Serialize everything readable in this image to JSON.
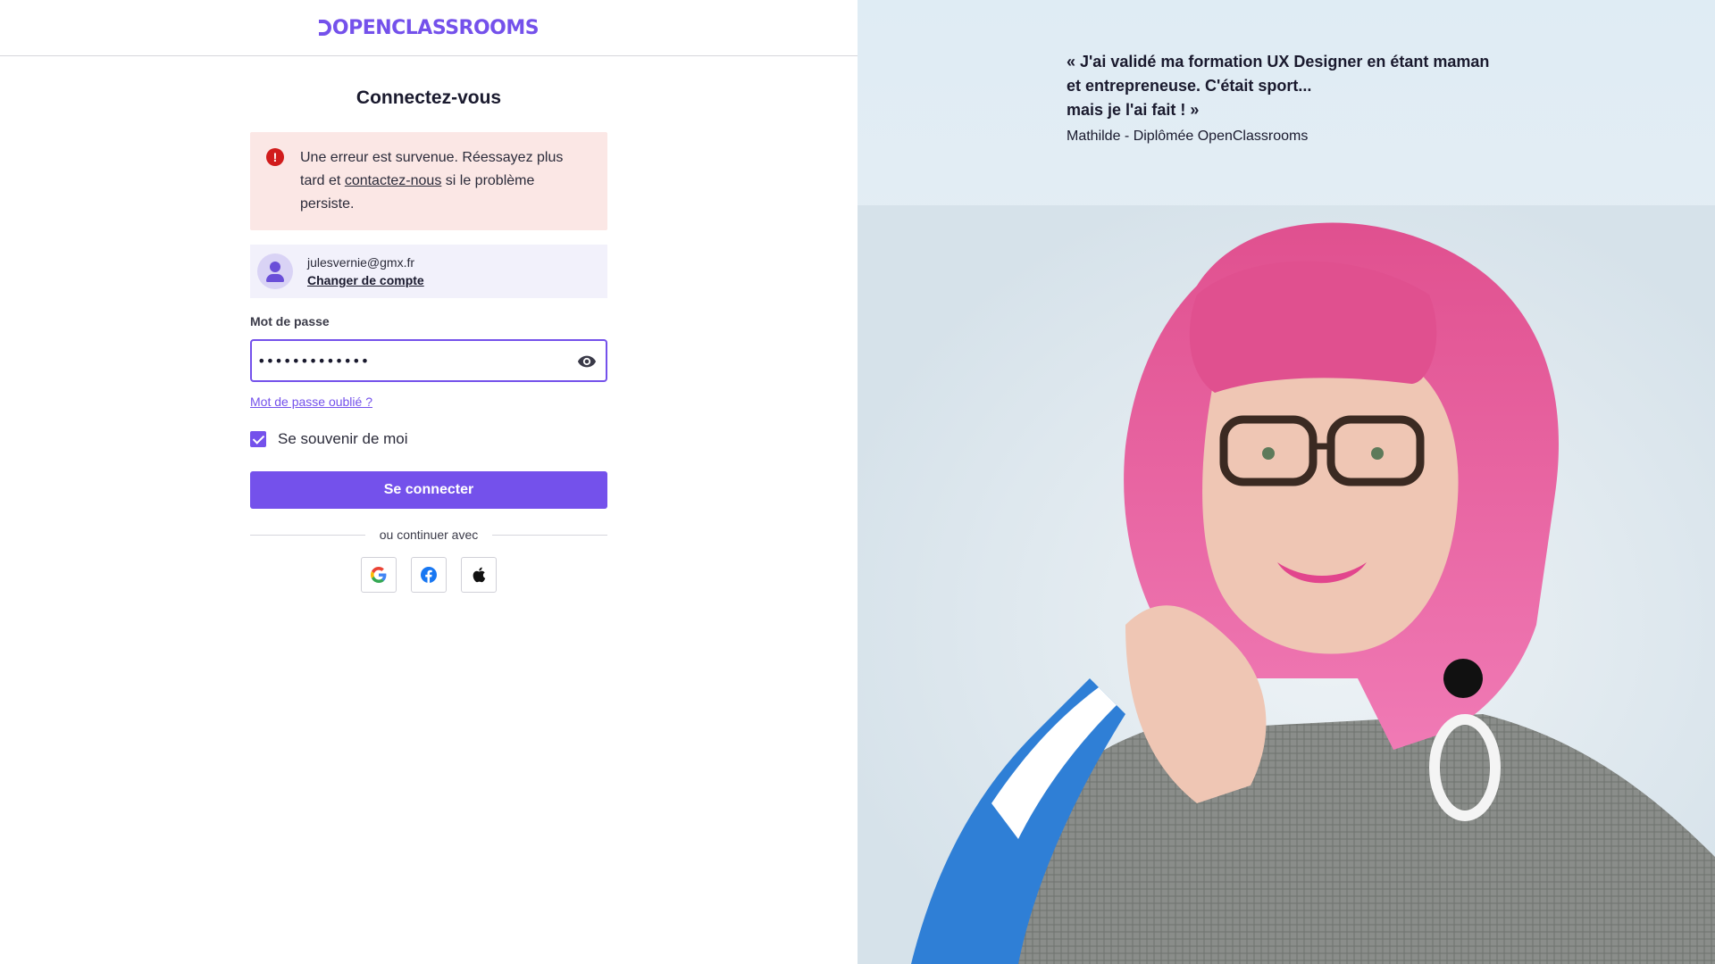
{
  "header": {
    "logo_text": "OPENCLASSROOMS"
  },
  "login": {
    "title": "Connectez-vous",
    "alert": {
      "icon": "exclamation-icon",
      "text_before": "Une erreur est survenue. Réessayez plus tard et ",
      "link": "contactez-nous",
      "text_after": " si le problème persiste."
    },
    "account": {
      "email": "julesvernie@gmx.fr",
      "switch_label": "Changer de compte"
    },
    "password": {
      "label": "Mot de passe",
      "value": "•••••••••••••"
    },
    "forgot_label": "Mot de passe oublié ?",
    "remember": {
      "label": "Se souvenir de moi",
      "checked": true
    },
    "submit_label": "Se connecter",
    "divider_text": "ou continuer avec",
    "social": [
      "google-icon",
      "facebook-icon",
      "apple-icon"
    ]
  },
  "testimonial": {
    "quote_lines": [
      "« J'ai validé ma formation UX Designer en étant maman",
      "et entrepreneuse. C'était sport...",
      "mais je l'ai fait ! »"
    ],
    "author": "Mathilde - Diplômée OpenClassrooms"
  },
  "colors": {
    "accent": "#7451eb",
    "error_bg": "#fbe7e5",
    "error_icon": "#d11c1c"
  }
}
